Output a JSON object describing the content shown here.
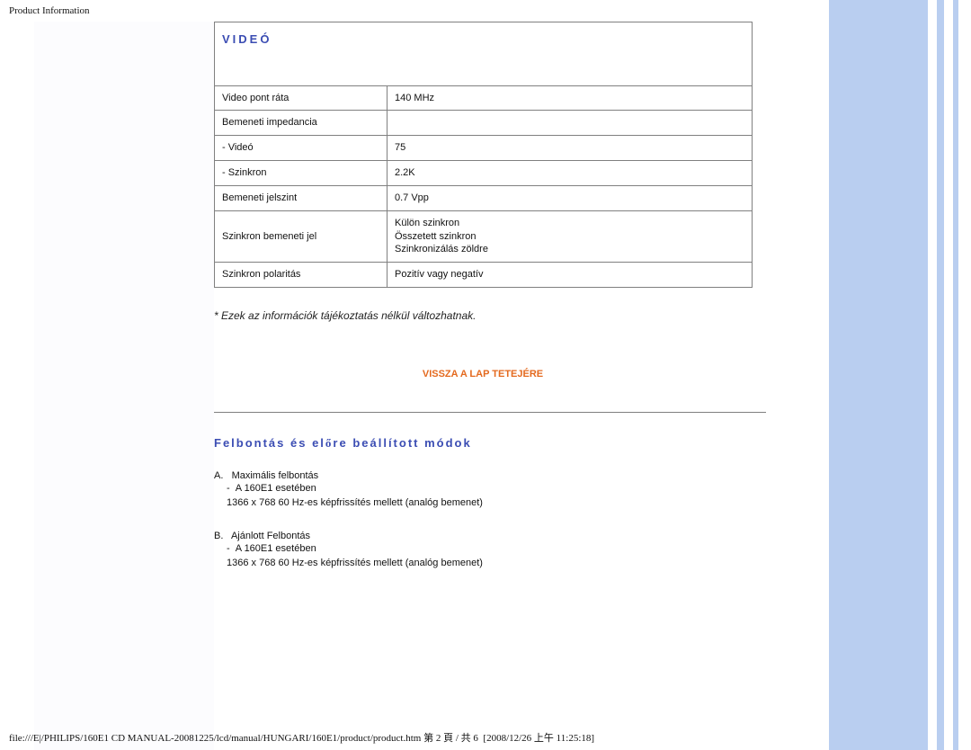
{
  "header": {
    "page_title": "Product Information"
  },
  "video": {
    "heading": "VIDEÓ",
    "rows": [
      {
        "label": "Video pont ráta",
        "value": "140 MHz"
      },
      {
        "label": "Bemeneti impedancia",
        "value": ""
      },
      {
        "label": "- Videó",
        "value": "75"
      },
      {
        "label": "- Szinkron",
        "value": "2.2K"
      },
      {
        "label": "Bemeneti jelszint",
        "value": "0.7 Vpp"
      },
      {
        "label": "Szinkron bemeneti jel",
        "value": "Külön szinkron\nÖsszetett szinkron\nSzinkronizálás zöldre"
      },
      {
        "label": "Szinkron polaritás",
        "value": "Pozitív vagy negatív"
      }
    ]
  },
  "disclaimer": "* Ezek az információk tájékoztatás nélkül változhatnak.",
  "back_to_top": "VISSZA A LAP TETEJÉRE",
  "resolution": {
    "heading_prefix": "Felbontás és el",
    "heading_accent": "ő",
    "heading_suffix": "re beállított módok",
    "blocks": [
      {
        "letter": "A.",
        "title": "Maximális felbontás",
        "bullet": "A 160E1 esetében",
        "detail": "1366 x 768 60 Hz-es képfrissítés mellett (analóg bemenet)"
      },
      {
        "letter": "B.",
        "title": "Ajánlott Felbontás",
        "bullet": "A 160E1 esetében",
        "detail": "1366 x 768 60 Hz-es képfrissítés mellett (analóg bemenet)"
      }
    ]
  },
  "footer": "file:///E|/PHILIPS/160E1 CD MANUAL-20081225/lcd/manual/HUNGARI/160E1/product/product.htm 第 2 頁 / 共 6  [2008/12/26 上午 11:25:18]"
}
